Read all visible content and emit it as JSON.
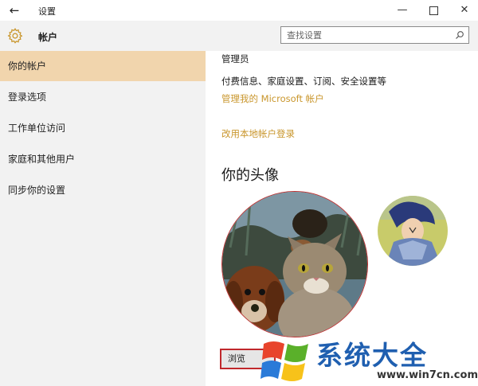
{
  "window": {
    "title": "设置"
  },
  "header": {
    "title": "帐户",
    "search_placeholder": "查找设置"
  },
  "sidebar": {
    "items": [
      {
        "label": "你的帐户",
        "active": true
      },
      {
        "label": "登录选项"
      },
      {
        "label": "工作单位访问"
      },
      {
        "label": "家庭和其他用户"
      },
      {
        "label": "同步你的设置"
      }
    ]
  },
  "content": {
    "role": "管理员",
    "info": "付费信息、家庭设置、订阅、安全设置等",
    "manage_link": "管理我的 Microsoft 帐户",
    "local_link": "改用本地帐户登录",
    "avatar_heading": "你的头像",
    "browse_label": "浏览"
  },
  "watermark": {
    "text": "系统大全",
    "url": "www.win7cn.com"
  },
  "colors": {
    "accent": "#c9962c",
    "active_nav": "#f1d5ad",
    "highlight_border": "#c0282c"
  }
}
